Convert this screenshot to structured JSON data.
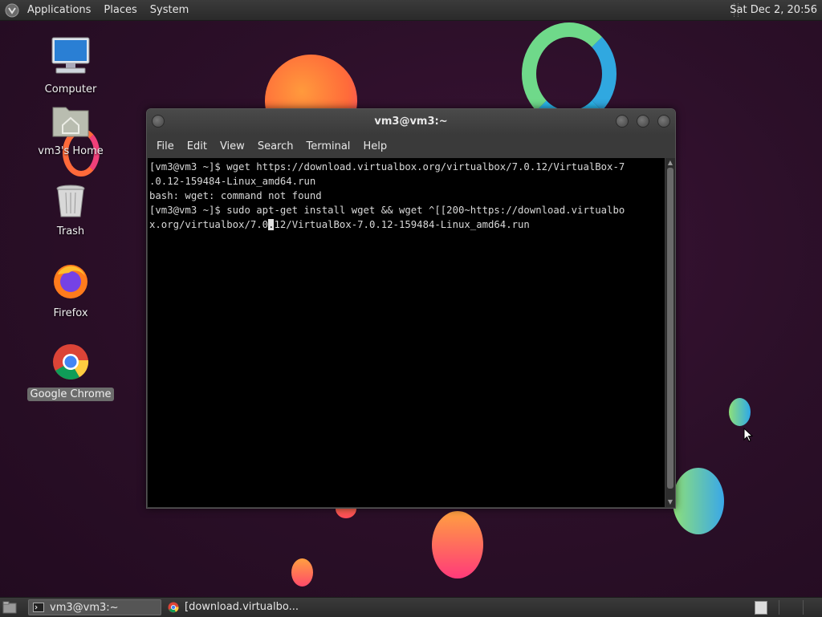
{
  "top_panel": {
    "menus": [
      "Applications",
      "Places",
      "System"
    ],
    "clock": "Sat Dec  2, 20:56"
  },
  "desktop": {
    "icons": [
      {
        "label": "Computer",
        "icon": "computer-icon"
      },
      {
        "label": "vm3's Home",
        "icon": "home-folder-icon"
      },
      {
        "label": "Trash",
        "icon": "trash-icon"
      },
      {
        "label": "Firefox",
        "icon": "firefox-icon"
      },
      {
        "label": "Google Chrome",
        "icon": "chrome-icon",
        "selected": true
      }
    ]
  },
  "terminal": {
    "title": "vm3@vm3:~",
    "menu": [
      "File",
      "Edit",
      "View",
      "Search",
      "Terminal",
      "Help"
    ],
    "lines": [
      "[vm3@vm3 ~]$ wget https://download.virtualbox.org/virtualbox/7.0.12/VirtualBox-7",
      ".0.12-159484-Linux_amd64.run",
      "bash: wget: command not found",
      "[vm3@vm3 ~]$ sudo apt-get install wget && wget ^[[200~https://download.virtualbo",
      "x.org/virtualbox/7.0"
    ],
    "cursor_char": ".",
    "line5_after_cursor": "12/VirtualBox-7.0.12-159484-Linux_amd64.run"
  },
  "taskbar": {
    "tasks": [
      {
        "label": "vm3@vm3:~",
        "icon": "terminal-icon",
        "active": true
      },
      {
        "label": "[download.virtualbo...",
        "icon": "chrome-icon",
        "active": false
      }
    ]
  },
  "colors": {
    "desktop_bg": "#2a0f26",
    "panel": "#333333",
    "terminal_bg": "#000000",
    "terminal_text": "#d8d8d8"
  }
}
